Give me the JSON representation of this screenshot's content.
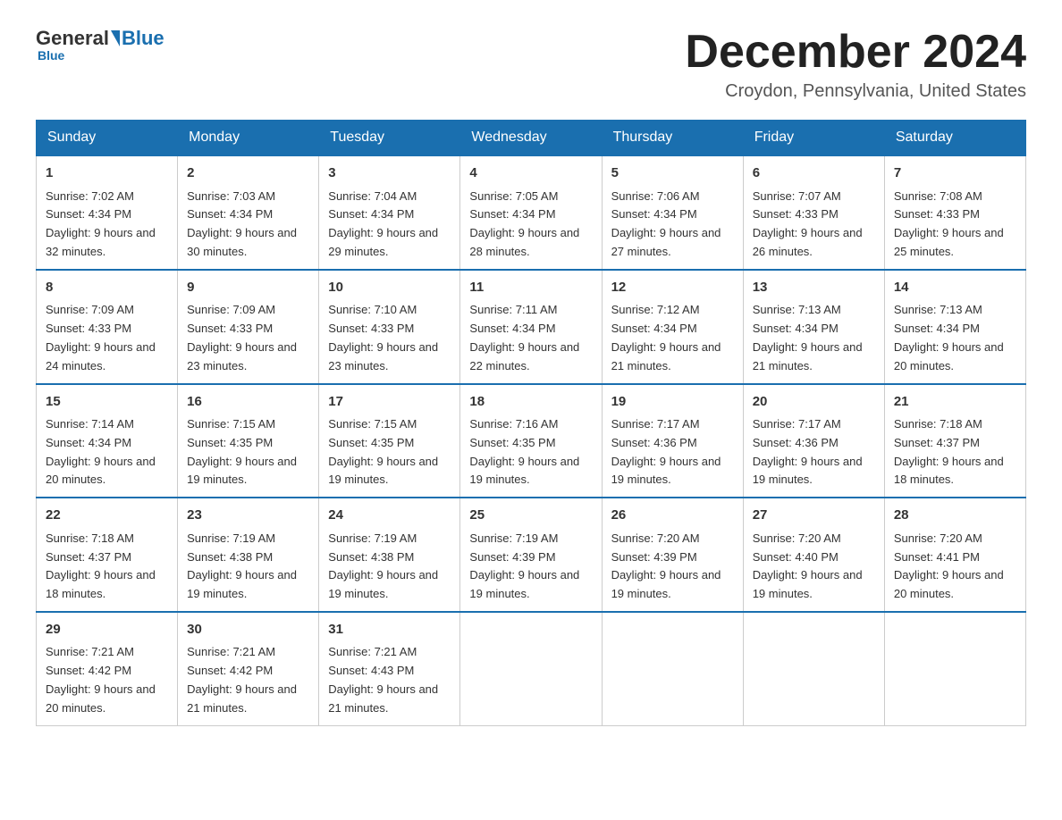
{
  "header": {
    "logo_general": "General",
    "logo_blue": "Blue",
    "month_title": "December 2024",
    "location": "Croydon, Pennsylvania, United States"
  },
  "days_of_week": [
    "Sunday",
    "Monday",
    "Tuesday",
    "Wednesday",
    "Thursday",
    "Friday",
    "Saturday"
  ],
  "weeks": [
    [
      {
        "day": "1",
        "sunrise": "7:02 AM",
        "sunset": "4:34 PM",
        "daylight": "9 hours and 32 minutes."
      },
      {
        "day": "2",
        "sunrise": "7:03 AM",
        "sunset": "4:34 PM",
        "daylight": "9 hours and 30 minutes."
      },
      {
        "day": "3",
        "sunrise": "7:04 AM",
        "sunset": "4:34 PM",
        "daylight": "9 hours and 29 minutes."
      },
      {
        "day": "4",
        "sunrise": "7:05 AM",
        "sunset": "4:34 PM",
        "daylight": "9 hours and 28 minutes."
      },
      {
        "day": "5",
        "sunrise": "7:06 AM",
        "sunset": "4:34 PM",
        "daylight": "9 hours and 27 minutes."
      },
      {
        "day": "6",
        "sunrise": "7:07 AM",
        "sunset": "4:33 PM",
        "daylight": "9 hours and 26 minutes."
      },
      {
        "day": "7",
        "sunrise": "7:08 AM",
        "sunset": "4:33 PM",
        "daylight": "9 hours and 25 minutes."
      }
    ],
    [
      {
        "day": "8",
        "sunrise": "7:09 AM",
        "sunset": "4:33 PM",
        "daylight": "9 hours and 24 minutes."
      },
      {
        "day": "9",
        "sunrise": "7:09 AM",
        "sunset": "4:33 PM",
        "daylight": "9 hours and 23 minutes."
      },
      {
        "day": "10",
        "sunrise": "7:10 AM",
        "sunset": "4:33 PM",
        "daylight": "9 hours and 23 minutes."
      },
      {
        "day": "11",
        "sunrise": "7:11 AM",
        "sunset": "4:34 PM",
        "daylight": "9 hours and 22 minutes."
      },
      {
        "day": "12",
        "sunrise": "7:12 AM",
        "sunset": "4:34 PM",
        "daylight": "9 hours and 21 minutes."
      },
      {
        "day": "13",
        "sunrise": "7:13 AM",
        "sunset": "4:34 PM",
        "daylight": "9 hours and 21 minutes."
      },
      {
        "day": "14",
        "sunrise": "7:13 AM",
        "sunset": "4:34 PM",
        "daylight": "9 hours and 20 minutes."
      }
    ],
    [
      {
        "day": "15",
        "sunrise": "7:14 AM",
        "sunset": "4:34 PM",
        "daylight": "9 hours and 20 minutes."
      },
      {
        "day": "16",
        "sunrise": "7:15 AM",
        "sunset": "4:35 PM",
        "daylight": "9 hours and 19 minutes."
      },
      {
        "day": "17",
        "sunrise": "7:15 AM",
        "sunset": "4:35 PM",
        "daylight": "9 hours and 19 minutes."
      },
      {
        "day": "18",
        "sunrise": "7:16 AM",
        "sunset": "4:35 PM",
        "daylight": "9 hours and 19 minutes."
      },
      {
        "day": "19",
        "sunrise": "7:17 AM",
        "sunset": "4:36 PM",
        "daylight": "9 hours and 19 minutes."
      },
      {
        "day": "20",
        "sunrise": "7:17 AM",
        "sunset": "4:36 PM",
        "daylight": "9 hours and 19 minutes."
      },
      {
        "day": "21",
        "sunrise": "7:18 AM",
        "sunset": "4:37 PM",
        "daylight": "9 hours and 18 minutes."
      }
    ],
    [
      {
        "day": "22",
        "sunrise": "7:18 AM",
        "sunset": "4:37 PM",
        "daylight": "9 hours and 18 minutes."
      },
      {
        "day": "23",
        "sunrise": "7:19 AM",
        "sunset": "4:38 PM",
        "daylight": "9 hours and 19 minutes."
      },
      {
        "day": "24",
        "sunrise": "7:19 AM",
        "sunset": "4:38 PM",
        "daylight": "9 hours and 19 minutes."
      },
      {
        "day": "25",
        "sunrise": "7:19 AM",
        "sunset": "4:39 PM",
        "daylight": "9 hours and 19 minutes."
      },
      {
        "day": "26",
        "sunrise": "7:20 AM",
        "sunset": "4:39 PM",
        "daylight": "9 hours and 19 minutes."
      },
      {
        "day": "27",
        "sunrise": "7:20 AM",
        "sunset": "4:40 PM",
        "daylight": "9 hours and 19 minutes."
      },
      {
        "day": "28",
        "sunrise": "7:20 AM",
        "sunset": "4:41 PM",
        "daylight": "9 hours and 20 minutes."
      }
    ],
    [
      {
        "day": "29",
        "sunrise": "7:21 AM",
        "sunset": "4:42 PM",
        "daylight": "9 hours and 20 minutes."
      },
      {
        "day": "30",
        "sunrise": "7:21 AM",
        "sunset": "4:42 PM",
        "daylight": "9 hours and 21 minutes."
      },
      {
        "day": "31",
        "sunrise": "7:21 AM",
        "sunset": "4:43 PM",
        "daylight": "9 hours and 21 minutes."
      },
      null,
      null,
      null,
      null
    ]
  ]
}
